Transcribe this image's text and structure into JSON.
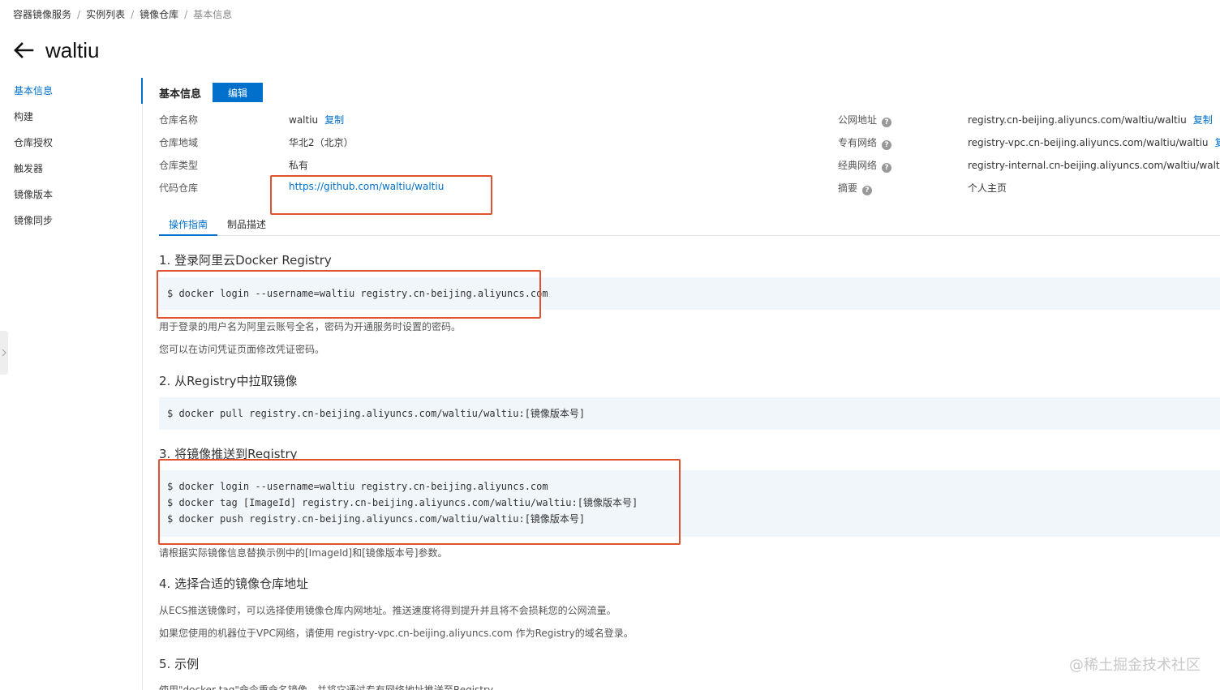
{
  "breadcrumb": [
    "容器镜像服务",
    "实例列表",
    "镜像仓库",
    "基本信息"
  ],
  "page_title": "waltiu",
  "sidebar": {
    "items": [
      {
        "label": "基本信息",
        "active": true
      },
      {
        "label": "构建"
      },
      {
        "label": "仓库授权"
      },
      {
        "label": "触发器"
      },
      {
        "label": "镜像版本"
      },
      {
        "label": "镜像同步"
      }
    ]
  },
  "info": {
    "section_title": "基本信息",
    "edit_label": "编辑",
    "copy_label": "复制",
    "left": [
      {
        "label": "仓库名称",
        "value": "waltiu"
      },
      {
        "label": "仓库地域",
        "value": "华北2（北京）"
      },
      {
        "label": "仓库类型",
        "value": "私有"
      },
      {
        "label": "代码仓库",
        "value": "https://github.com/waltiu/waltiu"
      }
    ],
    "right": [
      {
        "label": "公网地址",
        "value": "registry.cn-beijing.aliyuncs.com/waltiu/waltiu"
      },
      {
        "label": "专有网络",
        "value": "registry-vpc.cn-beijing.aliyuncs.com/waltiu/waltiu"
      },
      {
        "label": "经典网络",
        "value": "registry-internal.cn-beijing.aliyuncs.com/waltiu/waltiu"
      },
      {
        "label": "摘要",
        "value": "个人主页"
      }
    ],
    "copy_label_truncated": "复制"
  },
  "tabs": [
    {
      "label": "操作指南",
      "active": true
    },
    {
      "label": "制品描述"
    }
  ],
  "guide": {
    "step1": {
      "title": "1. 登录阿里云Docker Registry",
      "code": [
        "$ docker login --username=waltiu registry.cn-beijing.aliyuncs.com"
      ],
      "desc": [
        "用于登录的用户名为阿里云账号全名，密码为开通服务时设置的密码。",
        "您可以在访问凭证页面修改凭证密码。"
      ]
    },
    "step2": {
      "title": "2. 从Registry中拉取镜像",
      "code": [
        "$ docker pull registry.cn-beijing.aliyuncs.com/waltiu/waltiu:[镜像版本号]"
      ]
    },
    "step3": {
      "title": "3. 将镜像推送到Registry",
      "code": [
        "$ docker login --username=waltiu registry.cn-beijing.aliyuncs.com",
        "$ docker tag [ImageId] registry.cn-beijing.aliyuncs.com/waltiu/waltiu:[镜像版本号]",
        "$ docker push registry.cn-beijing.aliyuncs.com/waltiu/waltiu:[镜像版本号]"
      ],
      "desc": [
        "请根据实际镜像信息替换示例中的[ImageId]和[镜像版本号]参数。"
      ]
    },
    "step4": {
      "title": "4. 选择合适的镜像仓库地址",
      "desc": [
        "从ECS推送镜像时，可以选择使用镜像仓库内网地址。推送速度将得到提升并且将不会损耗您的公网流量。",
        "如果您使用的机器位于VPC网络，请使用 registry-vpc.cn-beijing.aliyuncs.com 作为Registry的域名登录。"
      ]
    },
    "step5": {
      "title": "5. 示例",
      "desc": [
        "使用\"docker tag\"命令重命名镜像，并将它通过专有网络地址推送至Registry。"
      ]
    }
  },
  "watermark": "@稀土掘金技术社区",
  "colors": {
    "accent": "#0070cc",
    "highlight_box": "#e0522f",
    "code_bg": "#f1f6fb"
  }
}
